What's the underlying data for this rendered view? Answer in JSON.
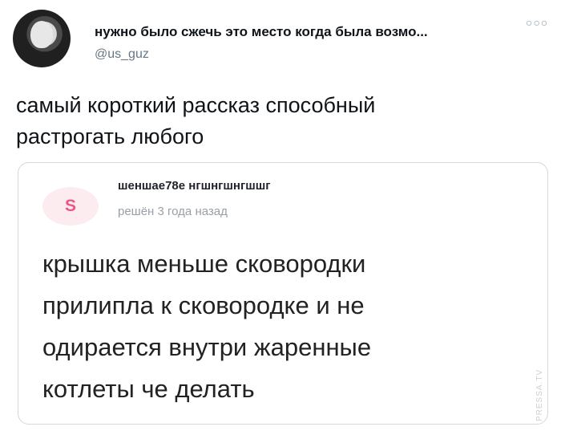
{
  "tweet": {
    "display_name": "нужно было сжечь это место когда была возмо...",
    "handle": "@us_guz",
    "more_icon": "more-icon",
    "text_lines": [
      "самый короткий рассказ способный",
      "растрогать любого"
    ]
  },
  "quote": {
    "avatar_letter": "S",
    "name": "шеншае78е нгшнгшнгшшг",
    "meta": "решён 3 года назад",
    "body_lines": [
      "крышка меньше сковородки",
      "прилипла к сковородке и не",
      "одирается внутри жаренные",
      "котлеты че делать"
    ]
  },
  "watermark": "PRESSA.TV"
}
